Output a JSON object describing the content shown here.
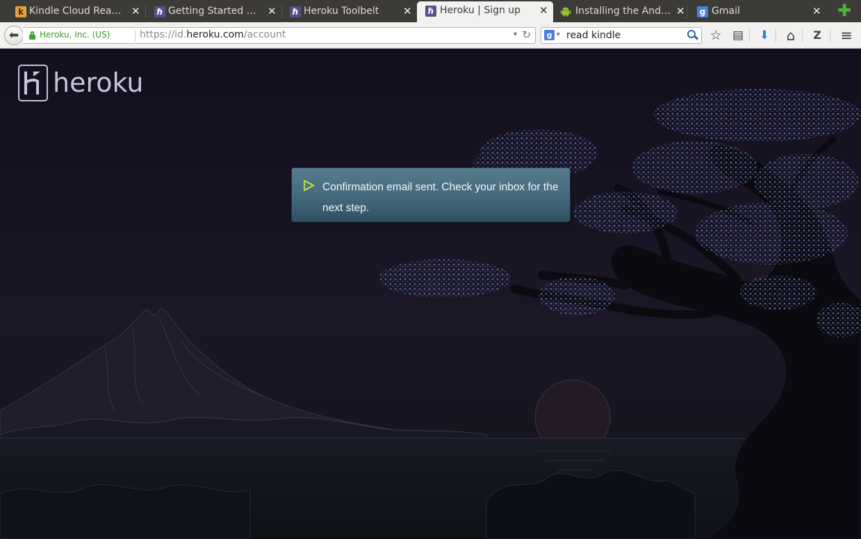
{
  "browser": {
    "tabs": [
      {
        "label": "Kindle Cloud Reader",
        "favicon": "kindle-icon",
        "active": false
      },
      {
        "label": "Getting Started wi…",
        "favicon": "heroku-icon",
        "active": false
      },
      {
        "label": "Heroku Toolbelt",
        "favicon": "heroku-icon",
        "active": false
      },
      {
        "label": "Heroku | Sign up",
        "favicon": "heroku-icon",
        "active": true
      },
      {
        "label": "Installing the Andr…",
        "favicon": "android-icon",
        "active": false
      },
      {
        "label": "Gmail",
        "favicon": "google-icon",
        "active": false
      }
    ],
    "favicon_glyphs": {
      "kindle": "k",
      "heroku": "ℏ",
      "google": "g"
    },
    "close_glyph": "✕",
    "new_tab_glyph": "✚",
    "identity": "Heroku, Inc. (US)",
    "url_prefix": "https://id.",
    "url_host": "heroku.com",
    "url_path": "/account",
    "search_value": "read kindle",
    "search_engine_glyph": "g",
    "accent_green": "#3aa52c",
    "toolbar": {
      "back_glyph": "⬅",
      "reload_glyph": "↻",
      "dropdown_glyph": "▾",
      "bookmark_glyph": "☆",
      "reading_list_glyph": "▤",
      "download_glyph": "⬇",
      "home_glyph": "⌂",
      "zotero_glyph": "Z",
      "menu_glyph": "≡"
    }
  },
  "page": {
    "logo_text": "heroku",
    "flash_message": "Confirmation email sent. Check your inbox for the next step.",
    "flash_color": "#44697c",
    "background_color": "#15121f"
  }
}
